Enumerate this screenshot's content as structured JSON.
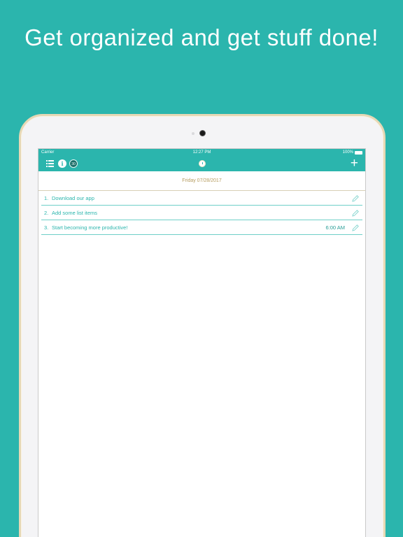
{
  "headline": "Get organized and get stuff done!",
  "status_bar": {
    "carrier": "Carrier",
    "time": "12:27 PM",
    "battery": "100%"
  },
  "nav": {
    "badge_count": "30",
    "info_glyph": "i",
    "add_glyph": "+"
  },
  "date_label": "Friday 07/28/2017",
  "items": [
    {
      "number": "1.",
      "text": "Download our app",
      "time": ""
    },
    {
      "number": "2.",
      "text": "Add some list items",
      "time": ""
    },
    {
      "number": "3.",
      "text": "Start becoming more productive!",
      "time": "6:00 AM"
    }
  ],
  "colors": {
    "background": "#2bb5ad",
    "accent": "#2bb5ad",
    "date": "#b59b5e",
    "badge": "#1b6e68"
  },
  "icons": {
    "menu": "list-icon",
    "info": "info-icon",
    "timer": "clock-icon",
    "add": "plus-icon",
    "edit": "pencil-icon"
  }
}
